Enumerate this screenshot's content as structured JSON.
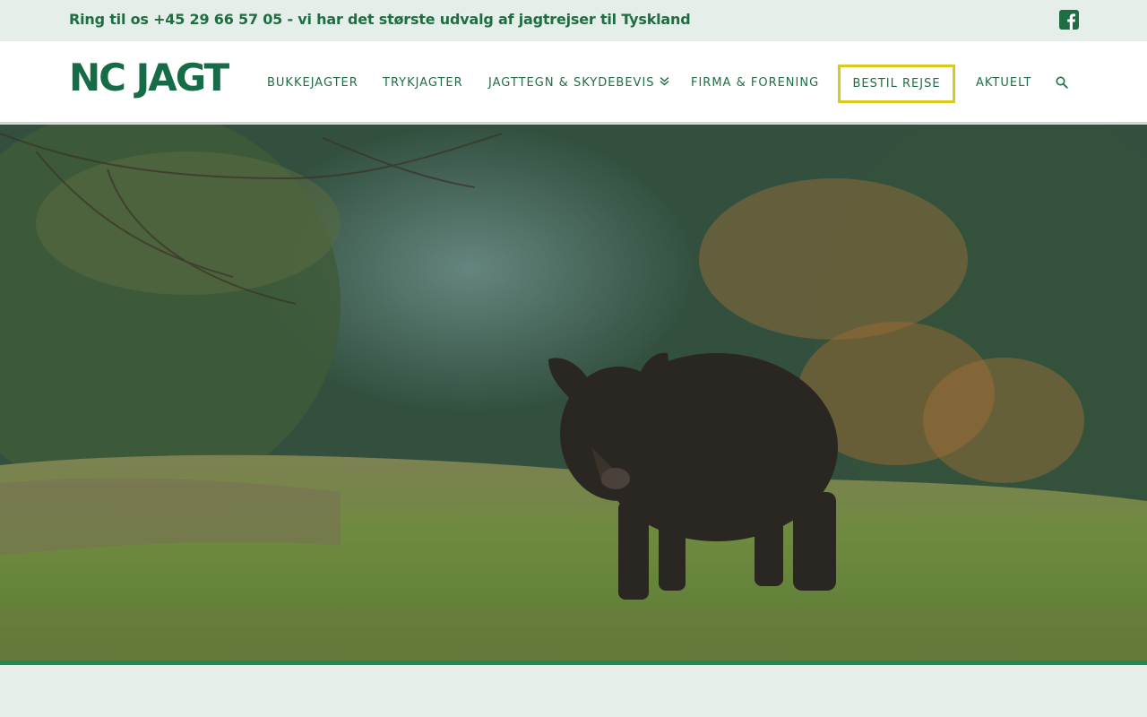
{
  "topbar": {
    "phone_text": "Ring til os +45 29 66 57 05 - vi har det største udvalg af jagtrejser til Tyskland",
    "social_icon": "facebook-square-icon"
  },
  "header": {
    "logo_text": "NC JAGT",
    "nav": [
      {
        "label": "BUKKEJAGTER"
      },
      {
        "label": "TRYKJAGTER"
      },
      {
        "label": "JAGTTEGN & SKYDEBEVIS"
      },
      {
        "label": "FIRMA & FORENING"
      },
      {
        "label": "BESTIL REJSE"
      },
      {
        "label": "AKTUELT"
      }
    ],
    "search_icon": "search-icon",
    "dropdown_icon": "chevron-double-down-icon"
  },
  "colors": {
    "brand_green": "#156c47",
    "text_green": "#1f6e43",
    "cta_border": "#d9cb1b",
    "accent_line": "#1e8a55",
    "topbar_bg": "#e6eee9"
  }
}
